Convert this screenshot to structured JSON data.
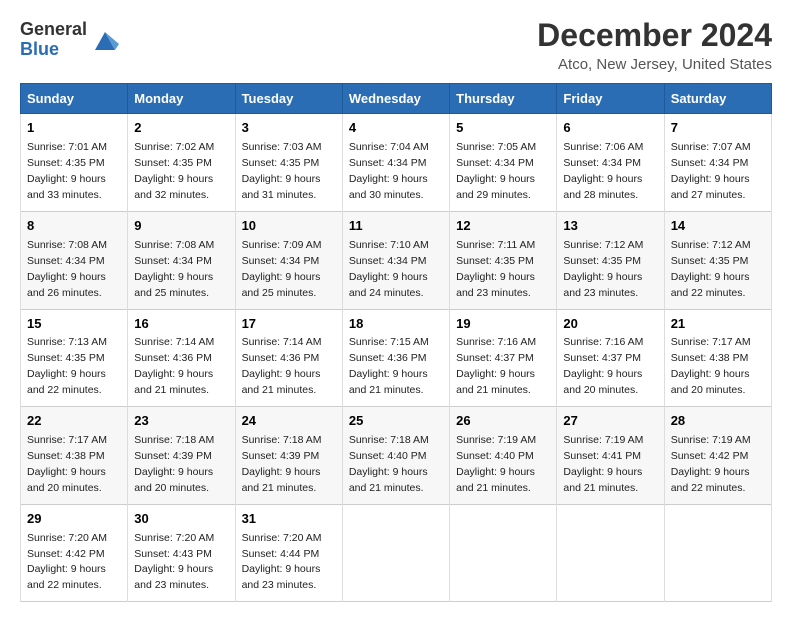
{
  "logo": {
    "general": "General",
    "blue": "Blue"
  },
  "title": "December 2024",
  "location": "Atco, New Jersey, United States",
  "days_of_week": [
    "Sunday",
    "Monday",
    "Tuesday",
    "Wednesday",
    "Thursday",
    "Friday",
    "Saturday"
  ],
  "weeks": [
    [
      {
        "day": "1",
        "sunrise": "7:01 AM",
        "sunset": "4:35 PM",
        "daylight": "9 hours and 33 minutes."
      },
      {
        "day": "2",
        "sunrise": "7:02 AM",
        "sunset": "4:35 PM",
        "daylight": "9 hours and 32 minutes."
      },
      {
        "day": "3",
        "sunrise": "7:03 AM",
        "sunset": "4:35 PM",
        "daylight": "9 hours and 31 minutes."
      },
      {
        "day": "4",
        "sunrise": "7:04 AM",
        "sunset": "4:34 PM",
        "daylight": "9 hours and 30 minutes."
      },
      {
        "day": "5",
        "sunrise": "7:05 AM",
        "sunset": "4:34 PM",
        "daylight": "9 hours and 29 minutes."
      },
      {
        "day": "6",
        "sunrise": "7:06 AM",
        "sunset": "4:34 PM",
        "daylight": "9 hours and 28 minutes."
      },
      {
        "day": "7",
        "sunrise": "7:07 AM",
        "sunset": "4:34 PM",
        "daylight": "9 hours and 27 minutes."
      }
    ],
    [
      {
        "day": "8",
        "sunrise": "7:08 AM",
        "sunset": "4:34 PM",
        "daylight": "9 hours and 26 minutes."
      },
      {
        "day": "9",
        "sunrise": "7:08 AM",
        "sunset": "4:34 PM",
        "daylight": "9 hours and 25 minutes."
      },
      {
        "day": "10",
        "sunrise": "7:09 AM",
        "sunset": "4:34 PM",
        "daylight": "9 hours and 25 minutes."
      },
      {
        "day": "11",
        "sunrise": "7:10 AM",
        "sunset": "4:34 PM",
        "daylight": "9 hours and 24 minutes."
      },
      {
        "day": "12",
        "sunrise": "7:11 AM",
        "sunset": "4:35 PM",
        "daylight": "9 hours and 23 minutes."
      },
      {
        "day": "13",
        "sunrise": "7:12 AM",
        "sunset": "4:35 PM",
        "daylight": "9 hours and 23 minutes."
      },
      {
        "day": "14",
        "sunrise": "7:12 AM",
        "sunset": "4:35 PM",
        "daylight": "9 hours and 22 minutes."
      }
    ],
    [
      {
        "day": "15",
        "sunrise": "7:13 AM",
        "sunset": "4:35 PM",
        "daylight": "9 hours and 22 minutes."
      },
      {
        "day": "16",
        "sunrise": "7:14 AM",
        "sunset": "4:36 PM",
        "daylight": "9 hours and 21 minutes."
      },
      {
        "day": "17",
        "sunrise": "7:14 AM",
        "sunset": "4:36 PM",
        "daylight": "9 hours and 21 minutes."
      },
      {
        "day": "18",
        "sunrise": "7:15 AM",
        "sunset": "4:36 PM",
        "daylight": "9 hours and 21 minutes."
      },
      {
        "day": "19",
        "sunrise": "7:16 AM",
        "sunset": "4:37 PM",
        "daylight": "9 hours and 21 minutes."
      },
      {
        "day": "20",
        "sunrise": "7:16 AM",
        "sunset": "4:37 PM",
        "daylight": "9 hours and 20 minutes."
      },
      {
        "day": "21",
        "sunrise": "7:17 AM",
        "sunset": "4:38 PM",
        "daylight": "9 hours and 20 minutes."
      }
    ],
    [
      {
        "day": "22",
        "sunrise": "7:17 AM",
        "sunset": "4:38 PM",
        "daylight": "9 hours and 20 minutes."
      },
      {
        "day": "23",
        "sunrise": "7:18 AM",
        "sunset": "4:39 PM",
        "daylight": "9 hours and 20 minutes."
      },
      {
        "day": "24",
        "sunrise": "7:18 AM",
        "sunset": "4:39 PM",
        "daylight": "9 hours and 21 minutes."
      },
      {
        "day": "25",
        "sunrise": "7:18 AM",
        "sunset": "4:40 PM",
        "daylight": "9 hours and 21 minutes."
      },
      {
        "day": "26",
        "sunrise": "7:19 AM",
        "sunset": "4:40 PM",
        "daylight": "9 hours and 21 minutes."
      },
      {
        "day": "27",
        "sunrise": "7:19 AM",
        "sunset": "4:41 PM",
        "daylight": "9 hours and 21 minutes."
      },
      {
        "day": "28",
        "sunrise": "7:19 AM",
        "sunset": "4:42 PM",
        "daylight": "9 hours and 22 minutes."
      }
    ],
    [
      {
        "day": "29",
        "sunrise": "7:20 AM",
        "sunset": "4:42 PM",
        "daylight": "9 hours and 22 minutes."
      },
      {
        "day": "30",
        "sunrise": "7:20 AM",
        "sunset": "4:43 PM",
        "daylight": "9 hours and 23 minutes."
      },
      {
        "day": "31",
        "sunrise": "7:20 AM",
        "sunset": "4:44 PM",
        "daylight": "9 hours and 23 minutes."
      },
      null,
      null,
      null,
      null
    ]
  ],
  "labels": {
    "sunrise": "Sunrise:",
    "sunset": "Sunset:",
    "daylight": "Daylight:"
  },
  "accent_color": "#2a6db5"
}
